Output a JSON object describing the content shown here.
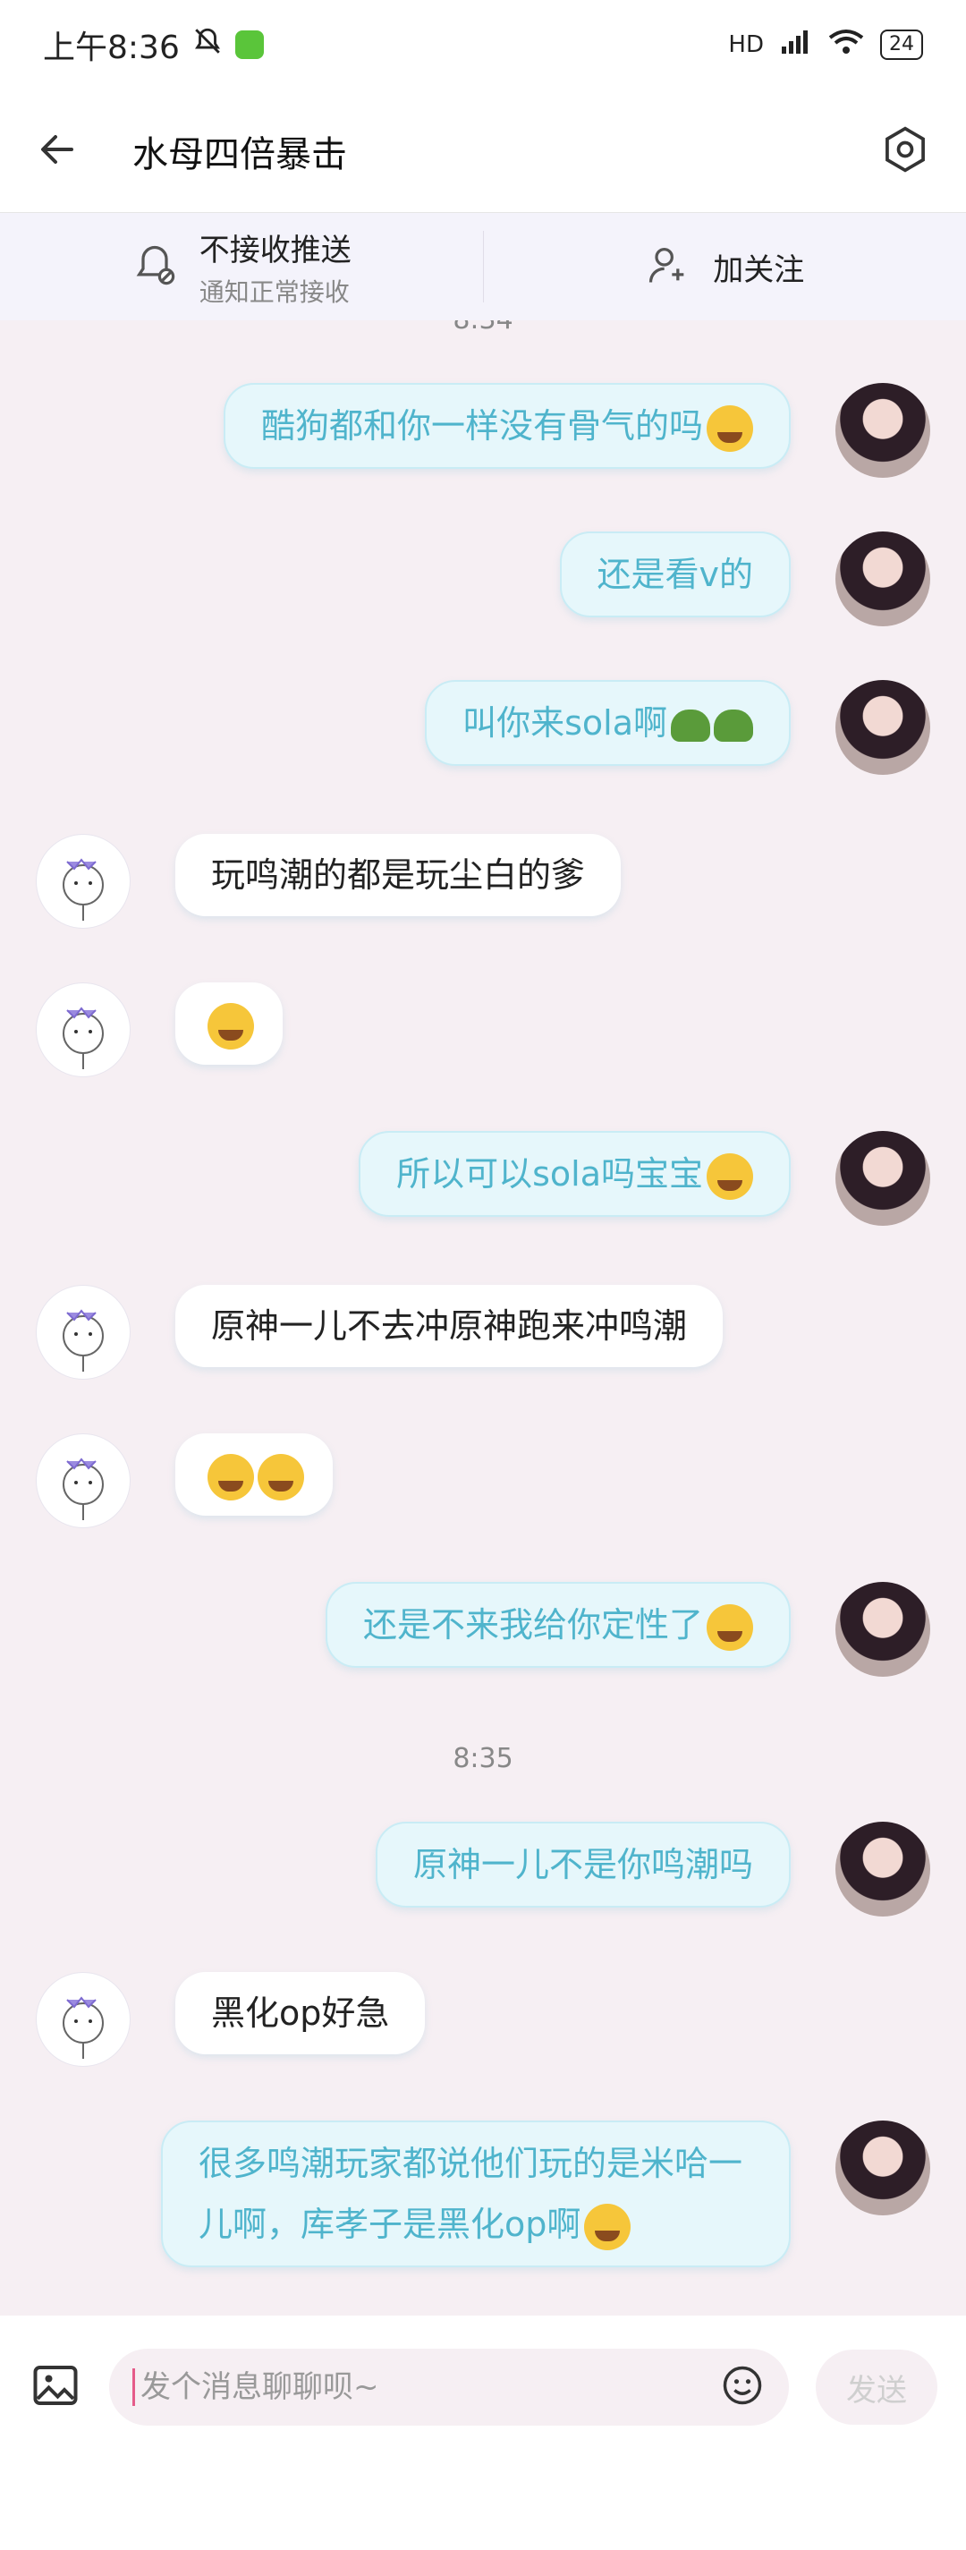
{
  "status_bar": {
    "time": "上午8:36",
    "hd_label": "HD",
    "battery": "24"
  },
  "header": {
    "title": "水母四倍暴击"
  },
  "subbar": {
    "push": {
      "label": "不接收推送",
      "sublabel": "通知正常接收"
    },
    "follow": {
      "label": "加关注"
    }
  },
  "chat": {
    "partial_timestamp": "8:34",
    "timestamp_2": "8:35",
    "messages": [
      {
        "side": "right",
        "text": "酷狗都和你一样没有骨气的吗",
        "emoji": "laughing-crying-emoji"
      },
      {
        "side": "right",
        "text": "还是看v的"
      },
      {
        "side": "right",
        "text": "叫你来sola啊",
        "emoji": "turtle-emoji x2"
      },
      {
        "side": "left",
        "text": "玩鸣潮的都是玩尘白的爹"
      },
      {
        "side": "left",
        "text": "",
        "emoji": "laughing-crying-emoji"
      },
      {
        "side": "right",
        "text": "所以可以sola吗宝宝",
        "emoji": "laughing-crying-emoji"
      },
      {
        "side": "left",
        "text": "原神一儿不去冲原神跑来冲鸣潮"
      },
      {
        "side": "left",
        "text": "",
        "emoji": "tears-of-joy-emoji x2"
      },
      {
        "side": "right",
        "text": "还是不来我给你定性了",
        "emoji": "laughing-crying-emoji"
      },
      {
        "side": "right",
        "text": "原神一儿不是你鸣潮吗"
      },
      {
        "side": "left",
        "text": "黑化op好急"
      },
      {
        "side": "right",
        "text": "很多鸣潮玩家都说他们玩的是米哈一儿啊，库孝子是黑化op啊",
        "emoji": "laughing-crying-emoji"
      }
    ]
  },
  "composer": {
    "placeholder": "发个消息聊聊呗~",
    "send_label": "发送"
  },
  "colors": {
    "background": "#f6eff3",
    "my_bubble_bg": "#e6f7fb",
    "my_bubble_text": "#4fb4cc",
    "other_bubble_bg": "#ffffff",
    "other_bubble_text": "#222222"
  }
}
